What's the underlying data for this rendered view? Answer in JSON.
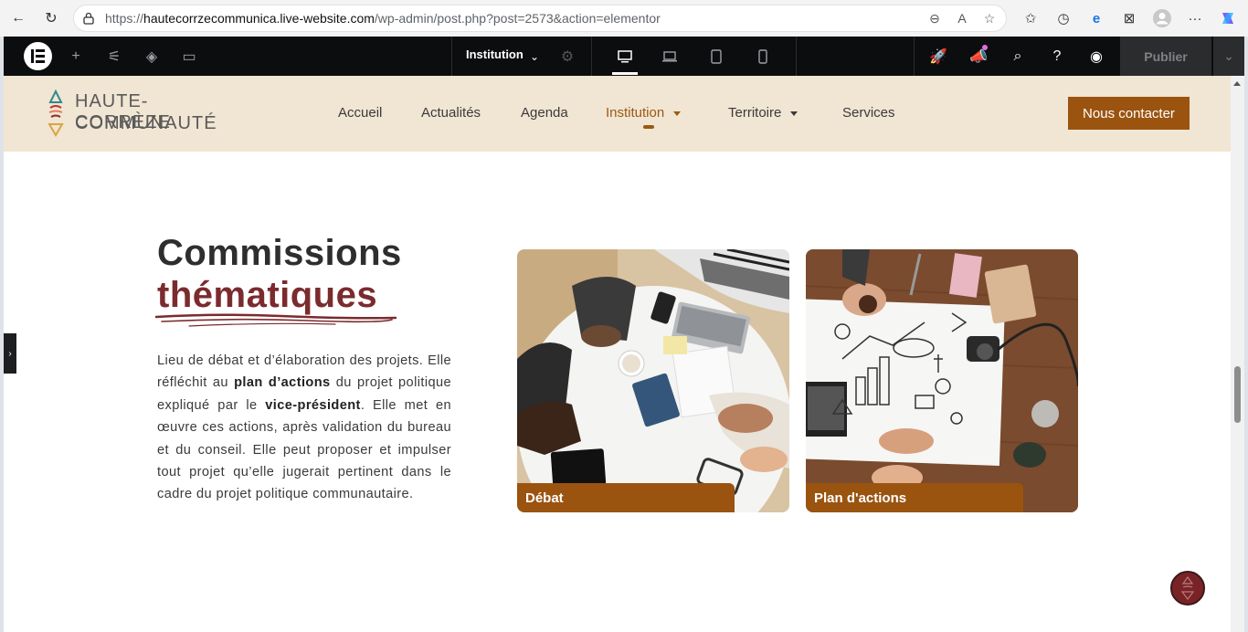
{
  "browser": {
    "url_prefix": "https://",
    "url_host": "hautecorrzecommunica.live-website.com",
    "url_path": "/wp-admin/post.php?post=2573&action=elementor"
  },
  "elementor": {
    "document_name": "Institution",
    "publish_label": "Publier"
  },
  "site": {
    "logo_line1": "HAUTE-CORRÈZE",
    "logo_line2": "COMMUNAUTÉ",
    "nav": [
      {
        "label": "Accueil"
      },
      {
        "label": "Actualités"
      },
      {
        "label": "Agenda"
      },
      {
        "label": "Institution"
      },
      {
        "label": "Territoire"
      },
      {
        "label": "Services"
      }
    ],
    "contact_label": "Nous contacter"
  },
  "section": {
    "title_line1": "Commissions",
    "title_line2": "thématiques",
    "p1": "Lieu de débat et d’élaboration des projets. Elle réfléchit au ",
    "b1": "plan d’actions",
    "p2": " du projet politique expliqué par le ",
    "b2": "vice-président",
    "p3": ". Elle met en œuvre ces actions, après validation du bureau et du conseil. Elle peut proposer et impulser tout projet qu’elle jugerait pertinent dans le cadre du projet politique communautaire.",
    "cards": [
      {
        "label": "Débat"
      },
      {
        "label": "Plan d'actions"
      }
    ]
  },
  "colors": {
    "accent": "#9a5410",
    "title_red": "#7b2b2e",
    "header_bg": "#f1e5d3"
  }
}
